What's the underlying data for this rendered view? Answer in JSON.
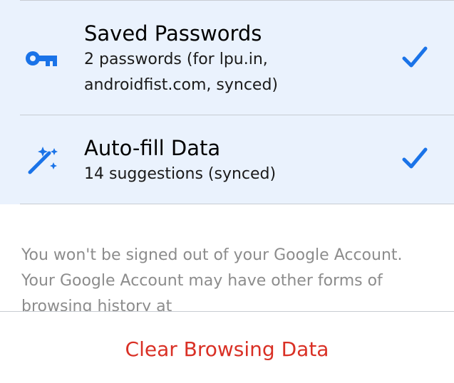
{
  "colors": {
    "list_background": "#eaf2fd",
    "accent_blue": "#1a73e8",
    "destructive_red": "#d93025",
    "notice_text": "#8c8c8c",
    "divider": "#c8ccd2"
  },
  "items": [
    {
      "icon": "key-icon",
      "title": "Saved Passwords",
      "subtitle": "2 passwords (for lpu.in, androidfist.com, synced)",
      "checked": true
    },
    {
      "icon": "magic-wand-icon",
      "title": "Auto-fill Data",
      "subtitle": "14 suggestions (synced)",
      "checked": true
    }
  ],
  "notice": "You won't be signed out of your Google Account. Your Google Account may have other forms of browsing history at",
  "footer": {
    "clear_label": "Clear Browsing Data"
  }
}
